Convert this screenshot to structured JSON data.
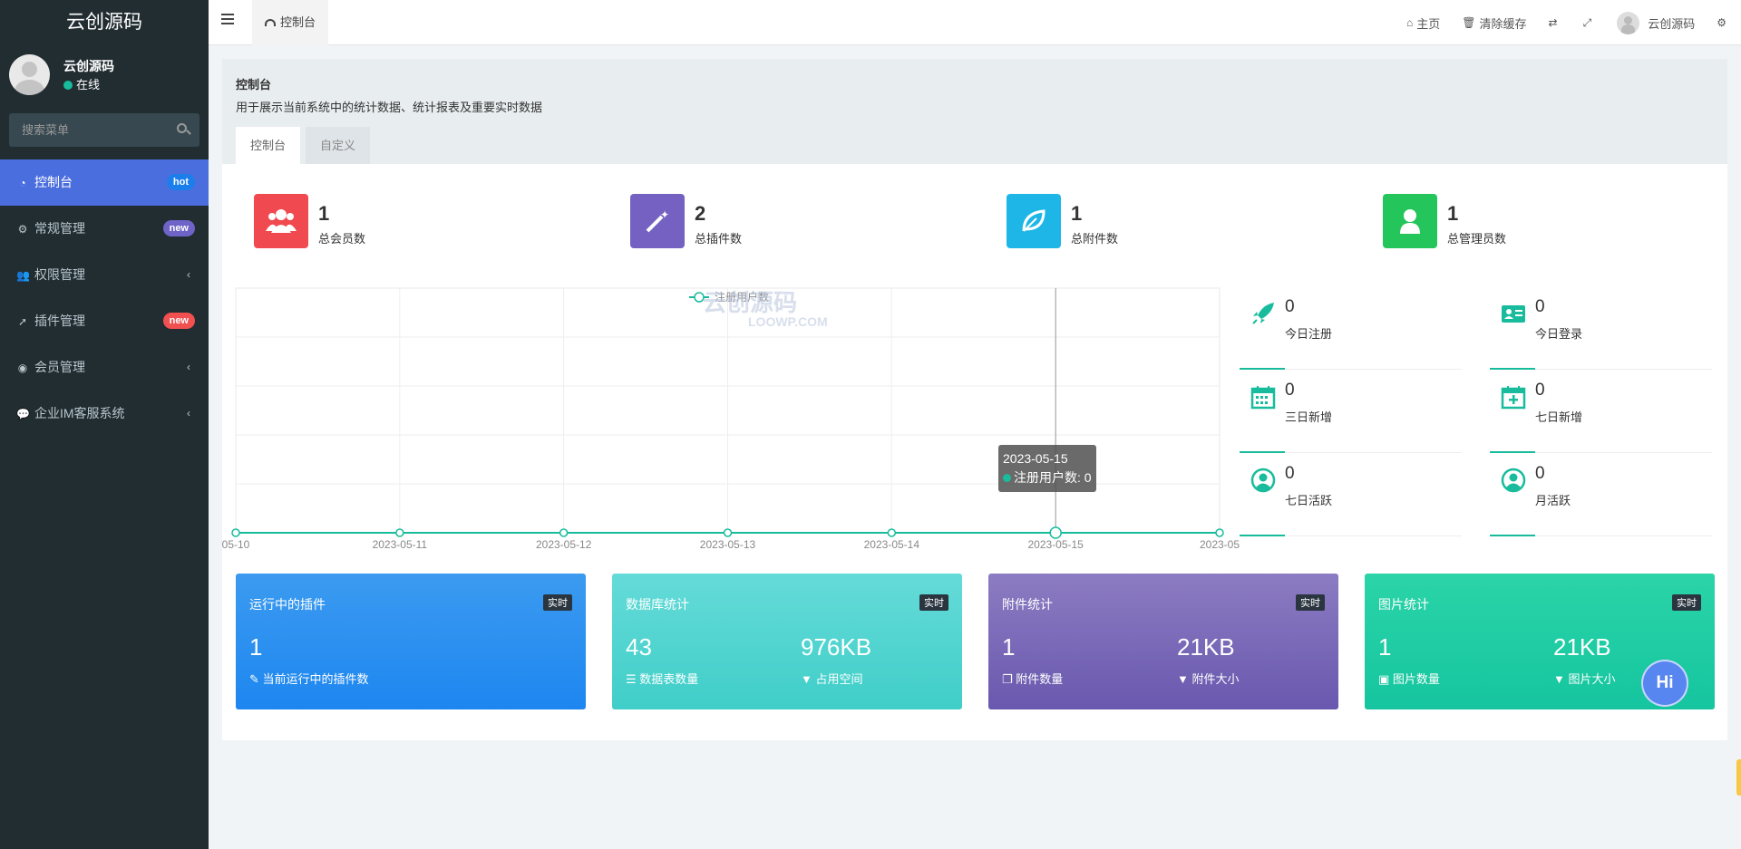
{
  "sidebar": {
    "logo": "云创源码",
    "user": {
      "name": "云创源码",
      "status": "在线"
    },
    "search_placeholder": "搜索菜单",
    "items": [
      {
        "label": "控制台",
        "icon": "dashboard-icon",
        "badge": "hot"
      },
      {
        "label": "常规管理",
        "icon": "cogs-icon",
        "badge": "new"
      },
      {
        "label": "权限管理",
        "icon": "users-icon"
      },
      {
        "label": "插件管理",
        "icon": "rocket-icon",
        "badge": "new"
      },
      {
        "label": "会员管理",
        "icon": "user-circle-icon"
      },
      {
        "label": "企业IM客服系统",
        "icon": "comment-icon"
      }
    ]
  },
  "topbar": {
    "tab_label": "控制台",
    "home": "主页",
    "clear_cache": "清除缓存",
    "username": "云创源码"
  },
  "panel": {
    "title": "控制台",
    "description": "用于展示当前系统中的统计数据、统计报表及重要实时数据",
    "tabs": [
      "控制台",
      "自定义"
    ]
  },
  "stats": [
    {
      "value": "1",
      "label": "总会员数",
      "color": "#f0494f",
      "icon": "users-icon"
    },
    {
      "value": "2",
      "label": "总插件数",
      "color": "#7561c2",
      "icon": "magic-wand-icon"
    },
    {
      "value": "1",
      "label": "总附件数",
      "color": "#1eb6e6",
      "icon": "leaf-icon"
    },
    {
      "value": "1",
      "label": "总管理员数",
      "color": "#24c55a",
      "icon": "user-icon"
    }
  ],
  "mini_stats": [
    {
      "value": "0",
      "label": "今日注册",
      "icon": "rocket-icon"
    },
    {
      "value": "0",
      "label": "今日登录",
      "icon": "id-card-icon"
    },
    {
      "value": "0",
      "label": "三日新增",
      "icon": "calendar-icon"
    },
    {
      "value": "0",
      "label": "七日新增",
      "icon": "calendar-plus-icon"
    },
    {
      "value": "0",
      "label": "七日活跃",
      "icon": "user-circle-icon"
    },
    {
      "value": "0",
      "label": "月活跃",
      "icon": "user-circle-icon"
    }
  ],
  "chart_data": {
    "type": "line",
    "legend": "注册用户数",
    "x_labels": [
      "05-10",
      "2023-05-11",
      "2023-05-12",
      "2023-05-13",
      "2023-05-14",
      "2023-05-15",
      "2023-05"
    ],
    "series": [
      {
        "name": "注册用户数",
        "values": [
          0,
          0,
          0,
          0,
          0,
          0,
          0
        ]
      }
    ],
    "grid": true,
    "legend_position": "top-center",
    "tooltip": {
      "date": "2023-05-15",
      "text": "注册用户数: 0"
    },
    "color": "#18bc9c"
  },
  "watermark": {
    "main": "云创源码",
    "sub": "LOOWP.COM"
  },
  "cards": [
    {
      "title": "运行中的插件",
      "badge": "实时",
      "cols": [
        {
          "value": "1",
          "label": "当前运行中的插件数"
        }
      ]
    },
    {
      "title": "数据库统计",
      "badge": "实时",
      "cols": [
        {
          "value": "43",
          "label": "数据表数量"
        },
        {
          "value": "976KB",
          "label": "占用空间"
        }
      ]
    },
    {
      "title": "附件统计",
      "badge": "实时",
      "cols": [
        {
          "value": "1",
          "label": "附件数量"
        },
        {
          "value": "21KB",
          "label": "附件大小"
        }
      ]
    },
    {
      "title": "图片统计",
      "badge": "实时",
      "cols": [
        {
          "value": "1",
          "label": "图片数量"
        },
        {
          "value": "21KB",
          "label": "图片大小"
        }
      ]
    }
  ],
  "chat_button": "Hi"
}
